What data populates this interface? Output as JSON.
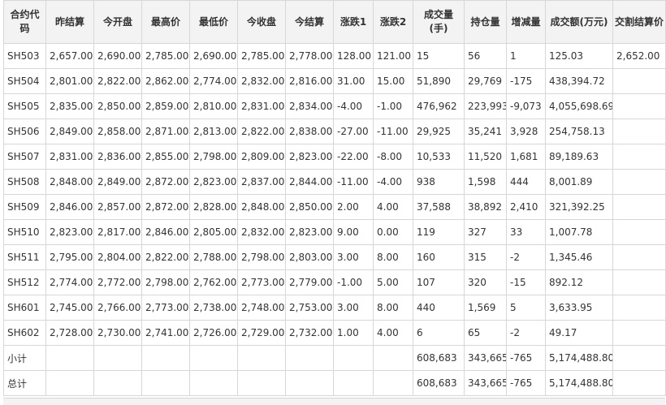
{
  "headers": [
    "合约代码",
    "昨结算",
    "今开盘",
    "最高价",
    "最低价",
    "今收盘",
    "今结算",
    "涨跌1",
    "涨跌2",
    "成交量(手)",
    "持仓量",
    "增减量",
    "成交额(万元)",
    "交割结算价"
  ],
  "rows": [
    [
      "SH503",
      "2,657.00",
      "2,690.00",
      "2,785.00",
      "2,690.00",
      "2,785.00",
      "2,778.00",
      "128.00",
      "121.00",
      "15",
      "56",
      "1",
      "125.03",
      "2,652.00"
    ],
    [
      "SH504",
      "2,801.00",
      "2,822.00",
      "2,862.00",
      "2,774.00",
      "2,832.00",
      "2,816.00",
      "31.00",
      "15.00",
      "51,890",
      "29,769",
      "-175",
      "438,394.72",
      ""
    ],
    [
      "SH505",
      "2,835.00",
      "2,850.00",
      "2,859.00",
      "2,810.00",
      "2,831.00",
      "2,834.00",
      "-4.00",
      "-1.00",
      "476,962",
      "223,993",
      "-9,073",
      "4,055,698.69",
      ""
    ],
    [
      "SH506",
      "2,849.00",
      "2,858.00",
      "2,871.00",
      "2,813.00",
      "2,822.00",
      "2,838.00",
      "-27.00",
      "-11.00",
      "29,925",
      "35,241",
      "3,928",
      "254,758.13",
      ""
    ],
    [
      "SH507",
      "2,831.00",
      "2,836.00",
      "2,855.00",
      "2,798.00",
      "2,809.00",
      "2,823.00",
      "-22.00",
      "-8.00",
      "10,533",
      "11,520",
      "1,681",
      "89,189.63",
      ""
    ],
    [
      "SH508",
      "2,848.00",
      "2,849.00",
      "2,872.00",
      "2,823.00",
      "2,837.00",
      "2,844.00",
      "-11.00",
      "-4.00",
      "938",
      "1,598",
      "444",
      "8,001.89",
      ""
    ],
    [
      "SH509",
      "2,846.00",
      "2,857.00",
      "2,872.00",
      "2,828.00",
      "2,848.00",
      "2,850.00",
      "2.00",
      "4.00",
      "37,588",
      "38,892",
      "2,410",
      "321,392.25",
      ""
    ],
    [
      "SH510",
      "2,823.00",
      "2,817.00",
      "2,846.00",
      "2,805.00",
      "2,832.00",
      "2,823.00",
      "9.00",
      "0.00",
      "119",
      "327",
      "33",
      "1,007.78",
      ""
    ],
    [
      "SH511",
      "2,795.00",
      "2,804.00",
      "2,822.00",
      "2,788.00",
      "2,798.00",
      "2,803.00",
      "3.00",
      "8.00",
      "160",
      "315",
      "-2",
      "1,345.46",
      ""
    ],
    [
      "SH512",
      "2,774.00",
      "2,772.00",
      "2,798.00",
      "2,762.00",
      "2,773.00",
      "2,779.00",
      "-1.00",
      "5.00",
      "107",
      "320",
      "-15",
      "892.12",
      ""
    ],
    [
      "SH601",
      "2,745.00",
      "2,766.00",
      "2,773.00",
      "2,738.00",
      "2,748.00",
      "2,753.00",
      "3.00",
      "8.00",
      "440",
      "1,569",
      "5",
      "3,633.95",
      ""
    ],
    [
      "SH602",
      "2,728.00",
      "2,730.00",
      "2,741.00",
      "2,726.00",
      "2,729.00",
      "2,732.00",
      "1.00",
      "4.00",
      "6",
      "65",
      "-2",
      "49.17",
      ""
    ],
    [
      "小计",
      "",
      "",
      "",
      "",
      "",
      "",
      "",
      "",
      "608,683",
      "343,665",
      "-765",
      "5,174,488.80",
      ""
    ],
    [
      "总计",
      "",
      "",
      "",
      "",
      "",
      "",
      "",
      "",
      "608,683",
      "343,665",
      "-765",
      "5,174,488.80",
      ""
    ]
  ]
}
